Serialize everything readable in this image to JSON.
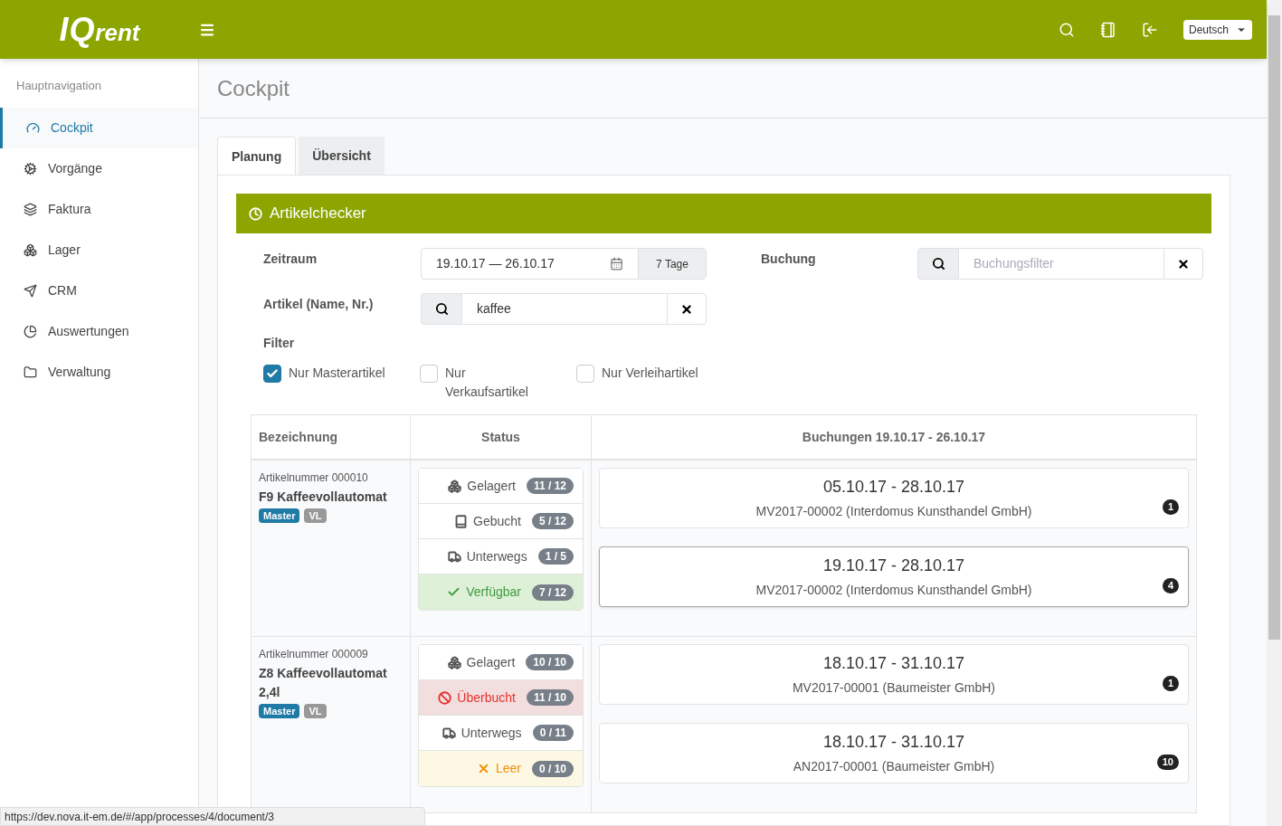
{
  "header": {
    "logo": {
      "part1": "IQ",
      "part2": "rent"
    },
    "language": "Deutsch"
  },
  "sidebar": {
    "heading": "Hauptnavigation",
    "items": [
      {
        "label": "Cockpit",
        "selected": true
      },
      {
        "label": "Vorgänge",
        "selected": false
      },
      {
        "label": "Faktura",
        "selected": false
      },
      {
        "label": "Lager",
        "selected": false
      },
      {
        "label": "CRM",
        "selected": false
      },
      {
        "label": "Auswertungen",
        "selected": false
      },
      {
        "label": "Verwaltung",
        "selected": false
      }
    ]
  },
  "page_title": "Cockpit",
  "tabs": [
    {
      "label": "Planung",
      "selected": true
    },
    {
      "label": "Übersicht",
      "selected": false
    }
  ],
  "panel": {
    "title": "Artikelchecker",
    "zeitraum": {
      "label": "Zeitraum",
      "value": "19.10.17 — 26.10.17",
      "button": "7 Tage"
    },
    "buchung": {
      "label": "Buchung",
      "placeholder": "Buchungsfilter"
    },
    "artikel": {
      "label": "Artikel (Name, Nr.)",
      "value": "kaffee"
    },
    "filter": {
      "label": "Filter",
      "options": [
        {
          "label": "Nur Masterartikel",
          "checked": true
        },
        {
          "label": "Nur Verkaufsartikel",
          "checked": false
        },
        {
          "label": "Nur Verleihartikel",
          "checked": false
        }
      ]
    }
  },
  "table": {
    "columns": [
      "Bezeichnung",
      "Status",
      "Buchungen 19.10.17 - 26.10.17"
    ],
    "rows": [
      {
        "number": "Artikelnummer 000010",
        "name": "F9 Kaffeevollautomat",
        "tags": [
          "Master",
          "VL"
        ],
        "status": [
          {
            "kind": "gelagert",
            "label": "Gelagert",
            "count": "11 / 12"
          },
          {
            "kind": "gebucht",
            "label": "Gebucht",
            "count": "5 / 12"
          },
          {
            "kind": "unterwegs",
            "label": "Unterwegs",
            "count": "1 / 5"
          },
          {
            "kind": "verfuegbar",
            "label": "Verfügbar",
            "count": "7 / 12"
          }
        ],
        "bookings": [
          {
            "dates": "05.10.17 - 28.10.17",
            "text": "MV2017-00002 (Interdomus Kunsthandel GmbH)",
            "count": "1",
            "selected": false
          },
          {
            "dates": "19.10.17 - 28.10.17",
            "text": "MV2017-00002 (Interdomus Kunsthandel GmbH)",
            "count": "4",
            "selected": true
          }
        ]
      },
      {
        "number": "Artikelnummer 000009",
        "name": "Z8 Kaffeevollautomat 2,4l",
        "tags": [
          "Master",
          "VL"
        ],
        "status": [
          {
            "kind": "gelagert",
            "label": "Gelagert",
            "count": "10 / 10"
          },
          {
            "kind": "ueberbucht",
            "label": "Überbucht",
            "count": "11 / 10"
          },
          {
            "kind": "unterwegs",
            "label": "Unterwegs",
            "count": "0 / 11"
          },
          {
            "kind": "leer",
            "label": "Leer",
            "count": "0 / 10"
          }
        ],
        "bookings": [
          {
            "dates": "18.10.17 - 31.10.17",
            "text": "MV2017-00001 (Baumeister GmbH)",
            "count": "1",
            "selected": false
          },
          {
            "dates": "18.10.17 - 31.10.17",
            "text": "AN2017-00001 (Baumeister GmbH)",
            "count": "10",
            "selected": false
          }
        ]
      }
    ]
  },
  "status_url": "https://dev.nova.it-em.de/#/app/processes/4/document/3"
}
